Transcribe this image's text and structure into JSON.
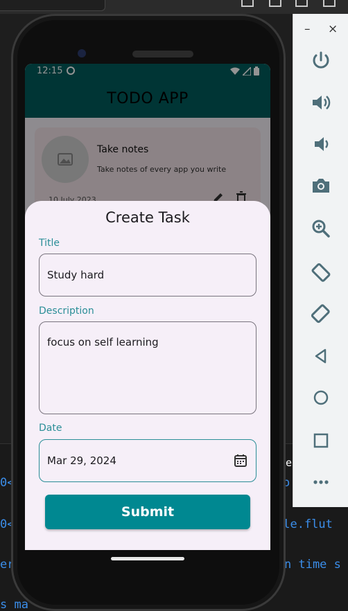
{
  "emulator": {
    "minimize": "–",
    "close": "×",
    "tools": [
      "power-icon",
      "volume-up-icon",
      "volume-down-icon",
      "camera-icon",
      "zoom-in-icon",
      "rotate-left-icon",
      "rotate-right-icon",
      "back-icon",
      "home-icon",
      "overview-icon",
      "more-icon"
    ]
  },
  "terminal": {
    "lines": [
      "0<",
      "0<",
      "er",
      "s ma"
    ],
    "right_lines": [
      "o",
      "ple.flut",
      "n time s"
    ],
    "marker": "e"
  },
  "status_bar": {
    "time": "12:15"
  },
  "app": {
    "title": "TODO APP"
  },
  "task_card": {
    "title": "Take notes",
    "description": "Take notes of every app you write",
    "date": "10 July 2023"
  },
  "sheet": {
    "title": "Create Task",
    "title_field": {
      "label": "Title",
      "value": "Study hard"
    },
    "description_field": {
      "label": "Description",
      "value": "focus on self learning"
    },
    "date_field": {
      "label": "Date",
      "value": "Mar 29, 2024"
    },
    "submit_label": "Submit"
  },
  "colors": {
    "app_bar": "#005c5c",
    "accent": "#2a8e97",
    "button": "#008891",
    "sheet_bg": "#f6eff8"
  }
}
